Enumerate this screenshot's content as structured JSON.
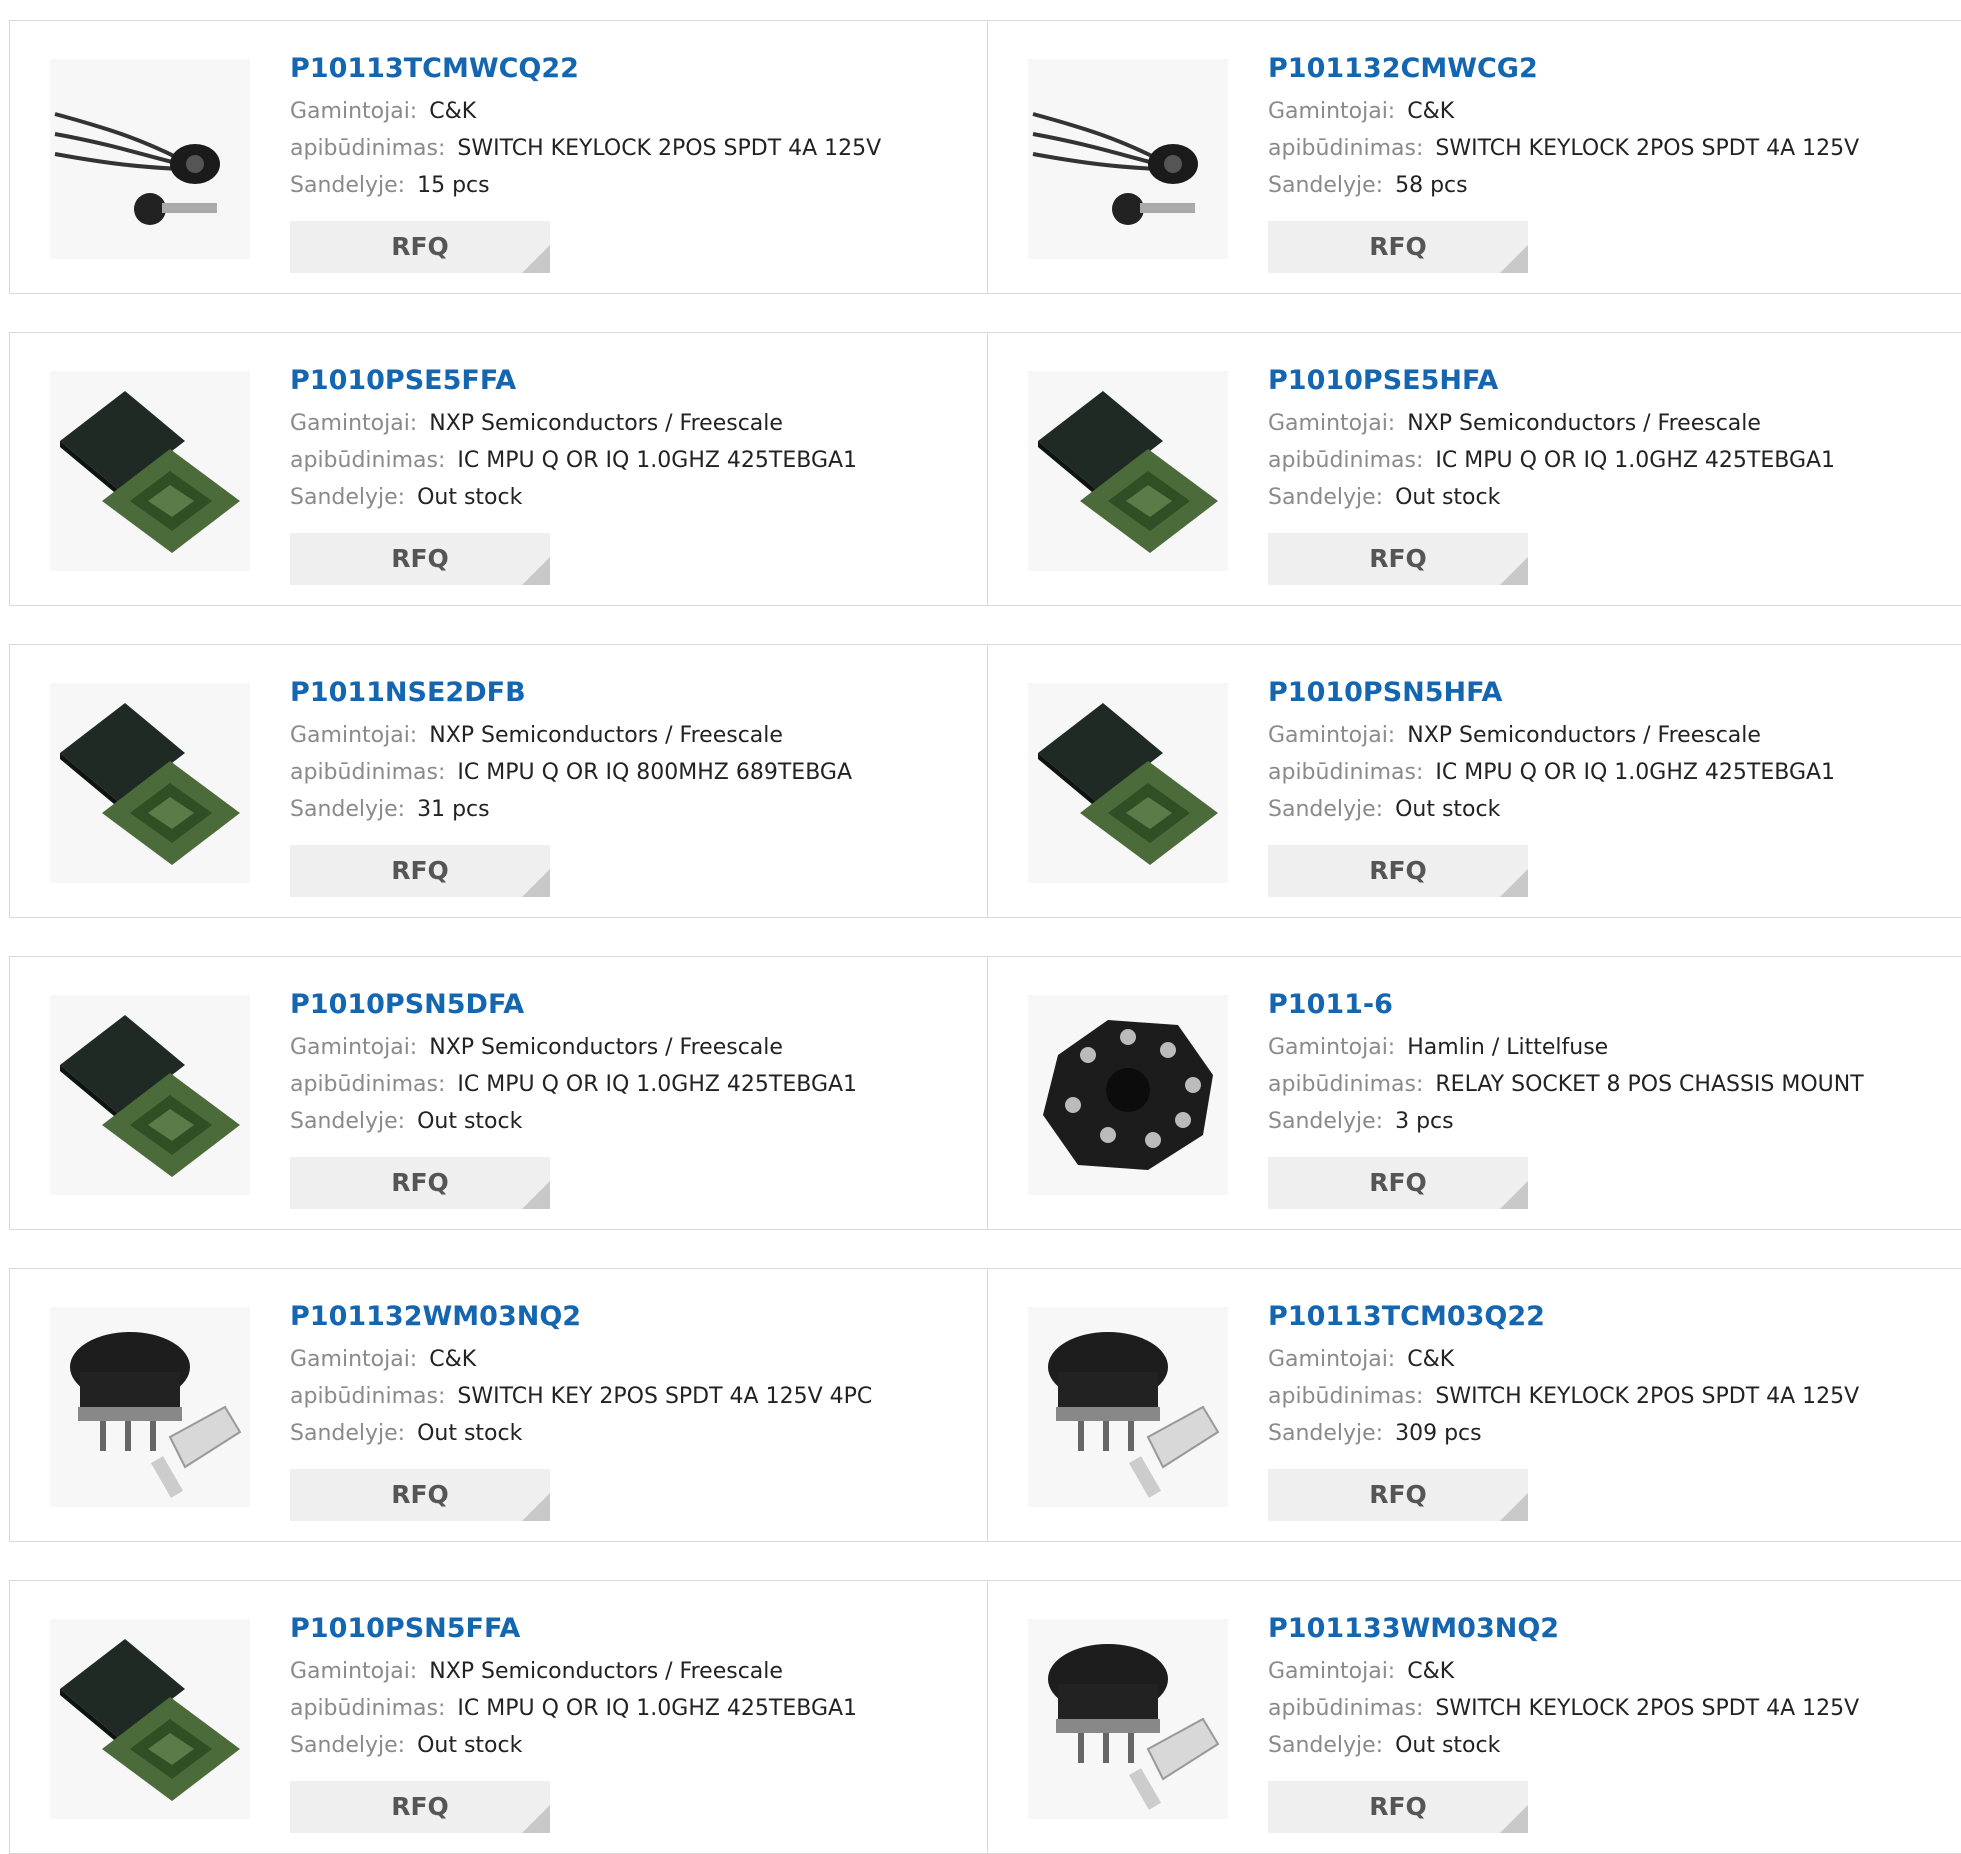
{
  "labels": {
    "manufacturer": "Gamintojai:",
    "description": "apibūdinimas:",
    "stock": "Sandelyje:",
    "rfq": "RFQ"
  },
  "rows": [
    [
      {
        "part": "P10113TCMWCQ22",
        "manufacturer": "C&K",
        "description": "SWITCH KEYLOCK 2POS SPDT 4A 125V",
        "stock": "15 pcs",
        "image": "keylock-wired-icon"
      },
      {
        "part": "P101132CMWCG2",
        "manufacturer": "C&K",
        "description": "SWITCH KEYLOCK 2POS SPDT 4A 125V",
        "stock": "58 pcs",
        "image": "keylock-wired-icon"
      }
    ],
    [
      {
        "part": "P1010PSE5FFA",
        "manufacturer": "NXP Semiconductors / Freescale",
        "description": "IC MPU Q OR IQ 1.0GHZ 425TEBGA1",
        "stock": "Out stock",
        "image": "bga-chip-icon"
      },
      {
        "part": "P1010PSE5HFA",
        "manufacturer": "NXP Semiconductors / Freescale",
        "description": "IC MPU Q OR IQ 1.0GHZ 425TEBGA1",
        "stock": "Out stock",
        "image": "bga-chip-icon"
      }
    ],
    [
      {
        "part": "P1011NSE2DFB",
        "manufacturer": "NXP Semiconductors / Freescale",
        "description": "IC MPU Q OR IQ 800MHZ 689TEBGA",
        "stock": "31 pcs",
        "image": "bga-chip-icon"
      },
      {
        "part": "P1010PSN5HFA",
        "manufacturer": "NXP Semiconductors / Freescale",
        "description": "IC MPU Q OR IQ 1.0GHZ 425TEBGA1",
        "stock": "Out stock",
        "image": "bga-chip-icon"
      }
    ],
    [
      {
        "part": "P1010PSN5DFA",
        "manufacturer": "NXP Semiconductors / Freescale",
        "description": "IC MPU Q OR IQ 1.0GHZ 425TEBGA1",
        "stock": "Out stock",
        "image": "bga-chip-icon"
      },
      {
        "part": "P1011-6",
        "manufacturer": "Hamlin / Littelfuse",
        "description": "RELAY SOCKET 8 POS CHASSIS MOUNT",
        "stock": "3 pcs",
        "image": "relay-socket-icon"
      }
    ],
    [
      {
        "part": "P101132WM03NQ2",
        "manufacturer": "C&K",
        "description": "SWITCH KEY 2POS SPDT 4A 125V 4PC",
        "stock": "Out stock",
        "image": "keyswitch-panel-icon"
      },
      {
        "part": "P10113TCM03Q22",
        "manufacturer": "C&K",
        "description": "SWITCH KEYLOCK 2POS SPDT 4A 125V",
        "stock": "309 pcs",
        "image": "keyswitch-panel-icon"
      }
    ],
    [
      {
        "part": "P1010PSN5FFA",
        "manufacturer": "NXP Semiconductors / Freescale",
        "description": "IC MPU Q OR IQ 1.0GHZ 425TEBGA1",
        "stock": "Out stock",
        "image": "bga-chip-icon"
      },
      {
        "part": "P101133WM03NQ2",
        "manufacturer": "C&K",
        "description": "SWITCH KEYLOCK 2POS SPDT 4A 125V",
        "stock": "Out stock",
        "image": "keyswitch-panel-icon"
      }
    ]
  ]
}
